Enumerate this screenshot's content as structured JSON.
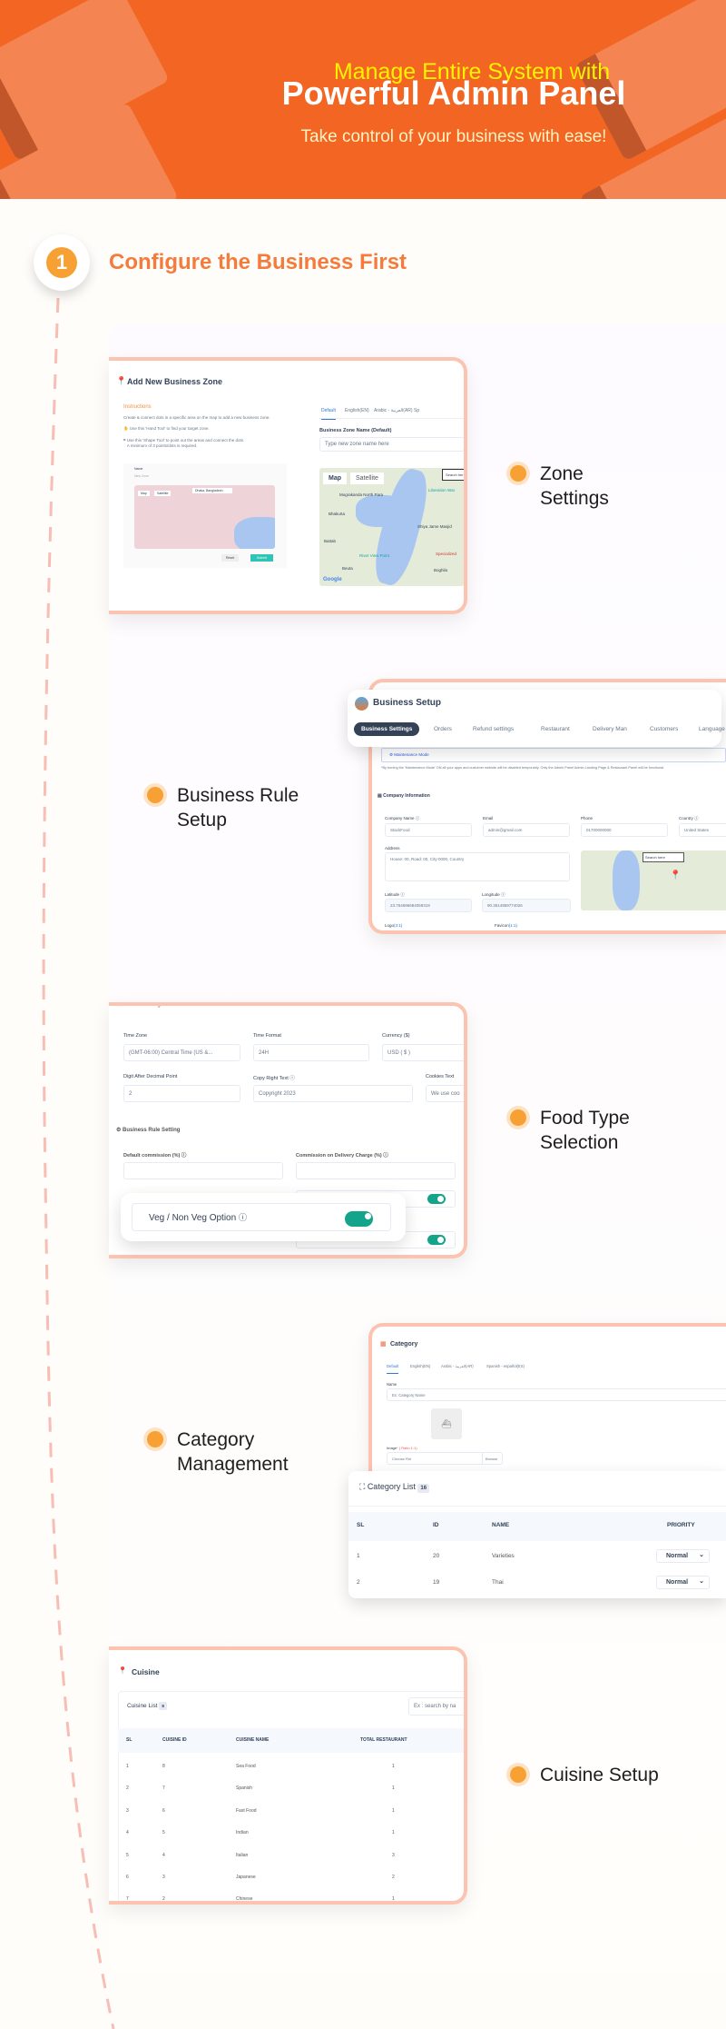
{
  "banner": {
    "line1": "Manage Entire System with",
    "line2": "Powerful Admin Panel",
    "subtitle": "Take control of your business with ease!"
  },
  "step": {
    "number": "1",
    "title": "Configure the Business First"
  },
  "colors": {
    "banner": "#f26522",
    "accent": "#f7a134",
    "title": "#f47b3c",
    "card_border": "#fcc4b0",
    "toggle": "#14a38b",
    "headline": "#fff200"
  },
  "features": [
    "Zone",
    "Settings",
    "Business Rule",
    "Setup",
    "Food Type",
    "Selection",
    "Category",
    "Management",
    "Cuisine Setup"
  ],
  "zone": {
    "title": "Add New Business Zone",
    "instructions": "Instructions",
    "desc": "Create & connect dots in a specific area on the map to add a new business zone.",
    "hand": "Use this 'Hand Tool' to find your target zone.",
    "shape1": "Use this 'Shape Tool' to point out the areas and connect the dots.",
    "shape2": "A minimum of 3 points/dots is required.",
    "mini_name": "Name",
    "mini_placeholder": "New Zone",
    "mini_map": "Map",
    "mini_sat": "Satellite",
    "mini_search": "Dhaka, Bangladesh",
    "reset": "Reset",
    "submit": "Submit",
    "tabs": [
      "Default",
      "English(EN)",
      "Arabic - العربية(AR)",
      "Sp"
    ],
    "name_label": "Business Zone Name (Default)",
    "name_placeholder": "Type new zone name here",
    "map": "Map",
    "satellite": "Satellite",
    "search": "Search her",
    "places": [
      "Mograkanda North Para",
      "Bhakurta",
      "Battab",
      "River View Point",
      "Beuta",
      "Boghila",
      "Liberation War",
      "Shiya Jame Masjid",
      "Specialized"
    ],
    "google": "Google"
  },
  "business": {
    "title": "Business Setup",
    "tabs": [
      "Business Settings",
      "Orders",
      "Refund settings",
      "Restaurant",
      "Delivery Man",
      "Customers",
      "Language"
    ],
    "maintenance": "Maintenance Mode",
    "maint_note": "*By turning the 'Maintenance Mode' ON all your apps and customer website will be disabled temporarily. Only the Admin Panel Admin Landing Page & Restaurant Panel will be functional.",
    "company_info": "Company Information",
    "fields": [
      {
        "label": "Company Name ⓘ",
        "value": "StackFood"
      },
      {
        "label": "Email",
        "value": "admin@gmail.com"
      },
      {
        "label": "Phone",
        "value": "01700000000"
      },
      {
        "label": "Country ⓘ",
        "value": "United States"
      }
    ],
    "address_label": "Address",
    "address": "House: 00, Road: 00, City-0000, Country",
    "lat_label": "Latitude ⓘ",
    "lat": "23.764696684059319",
    "lng_label": "Longitude ⓘ",
    "lng": "90.3514959774026",
    "logo": "Logo",
    "logo_ratio": "(3:1)",
    "favicon": "Favicon",
    "favicon_ratio": "(1:1)",
    "map_search": "Search here"
  },
  "general": {
    "heading": "General Settings",
    "time_zone_label": "Time Zone",
    "time_zone": "(GMT-06:00) Central Time (US &...",
    "time_format_label": "Time Format",
    "time_format": "24H",
    "currency_label": "Currency ($)",
    "currency": "USD ( $ )",
    "digit_label": "Digit After Decimal Point",
    "digit": "2",
    "copyright_label": "Copy Right Text ⓘ",
    "copyright": "Copyright 2023",
    "cookies_label": "Cookies Text",
    "cookies": "We use coo",
    "rule_heading": "Business Rule Setting",
    "commission_label": "Default commission (%) ⓘ",
    "delivery_commission_label": "Commission on Delivery Charge (%) ⓘ",
    "veg_option": "Veg / Non Veg Option",
    "veg_enabled": true
  },
  "category": {
    "title": "Category",
    "tabs": [
      "Default",
      "English(EN)",
      "Arabic - العربية(AR)",
      "Spanish - español(ES)"
    ],
    "name_label": "Name",
    "name_placeholder": "Ex: Category Name",
    "image_label": "Image",
    "image_ratio": "* ( Ratio 1:1)",
    "choose_file": "Choose File",
    "browse": "Browse",
    "list_title": "Category List",
    "count": "16",
    "columns": [
      "SL",
      "ID",
      "NAME",
      "PRIORITY"
    ],
    "rows": [
      [
        "1",
        "20",
        "Varieties",
        "Normal"
      ],
      [
        "2",
        "19",
        "Thai",
        "Normal"
      ]
    ]
  },
  "cuisine": {
    "title": "Cuisine",
    "list_title": "Cuisine List",
    "count": "8",
    "search_placeholder": "Ex : search by na",
    "columns": [
      "SL",
      "CUISINE ID",
      "CUISINE NAME",
      "TOTAL RESTAURANT"
    ],
    "rows": [
      [
        "1",
        "8",
        "Sea Food",
        "1"
      ],
      [
        "2",
        "7",
        "Spanish",
        "1"
      ],
      [
        "3",
        "6",
        "Fast Food",
        "1"
      ],
      [
        "4",
        "5",
        "Indian",
        "1"
      ],
      [
        "5",
        "4",
        "Italian",
        "3"
      ],
      [
        "6",
        "3",
        "Japanese",
        "2"
      ],
      [
        "7",
        "2",
        "Chinese",
        "1"
      ]
    ]
  }
}
